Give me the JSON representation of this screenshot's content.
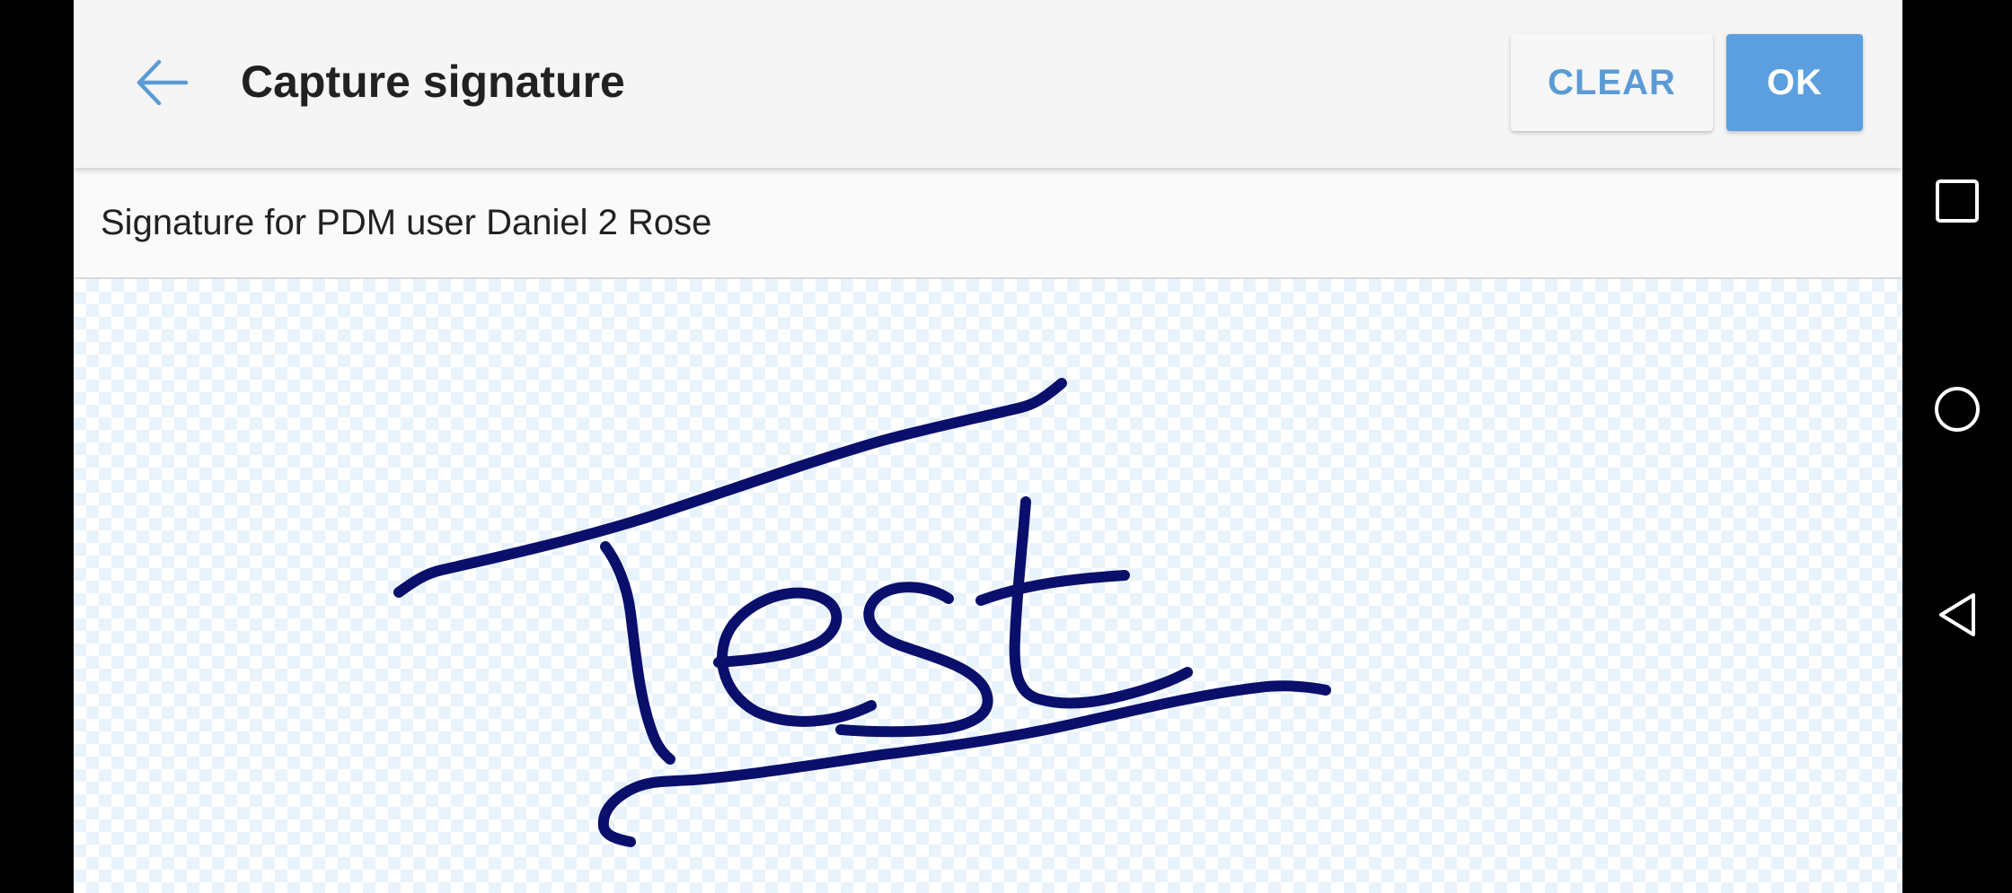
{
  "toolbar": {
    "back_icon": "arrow-left-icon",
    "title": "Capture signature",
    "clear_label": "CLEAR",
    "ok_label": "OK"
  },
  "subtitle": "Signature for PDM user Daniel 2 Rose",
  "signature": {
    "ink_color": "#0a0f6b",
    "text": "Test"
  },
  "nav": {
    "recents_icon": "square-recents-icon",
    "home_icon": "circle-home-icon",
    "back_icon": "triangle-back-icon"
  },
  "colors": {
    "accent": "#5b9fdf",
    "toolbar_bg": "#f5f5f5",
    "pad_pattern": "#e9f3fc"
  }
}
